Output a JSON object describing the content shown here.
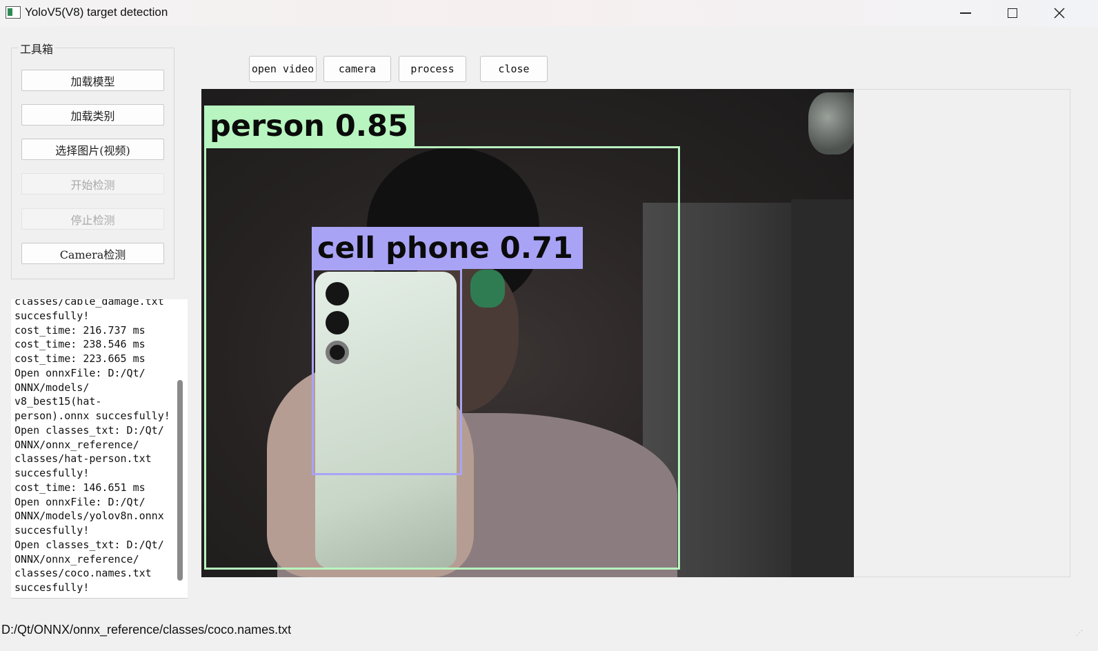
{
  "window": {
    "title": "YoloV5(V8) target detection"
  },
  "toolbox": {
    "title": "工具箱",
    "buttons": [
      {
        "label": "加载模型",
        "enabled": true
      },
      {
        "label": "加载类别",
        "enabled": true
      },
      {
        "label": "选择图片(视频)",
        "enabled": true
      },
      {
        "label": "开始检测",
        "enabled": false
      },
      {
        "label": "停止检测",
        "enabled": false
      },
      {
        "label": "Camera检测",
        "enabled": true
      }
    ]
  },
  "log": {
    "lines": [
      "classes/cable_damage.txt",
      "succesfully!",
      "cost_time: 216.737 ms",
      "cost_time: 238.546 ms",
      "cost_time: 223.665 ms",
      "Open onnxFile: D:/Qt/",
      "ONNX/models/",
      "v8_best15(hat-",
      "person).onnx succesfully!",
      "Open classes_txt: D:/Qt/",
      "ONNX/onnx_reference/",
      "classes/hat-person.txt",
      "succesfully!",
      "cost_time: 146.651 ms",
      "Open onnxFile: D:/Qt/",
      "ONNX/models/yolov8n.onnx",
      "succesfully!",
      "Open classes_txt: D:/Qt/",
      "ONNX/onnx_reference/",
      "classes/coco.names.txt",
      "succesfully!"
    ]
  },
  "toolbar": {
    "open_video": "open video",
    "camera": "camera",
    "process": "process",
    "close": "close"
  },
  "detections": [
    {
      "label": "person 0.85",
      "color": "#b8f5c0"
    },
    {
      "label": "cell phone 0.71",
      "color": "#a9a3f6"
    }
  ],
  "status": {
    "text": "D:/Qt/ONNX/onnx_reference/classes/coco.names.txt"
  }
}
